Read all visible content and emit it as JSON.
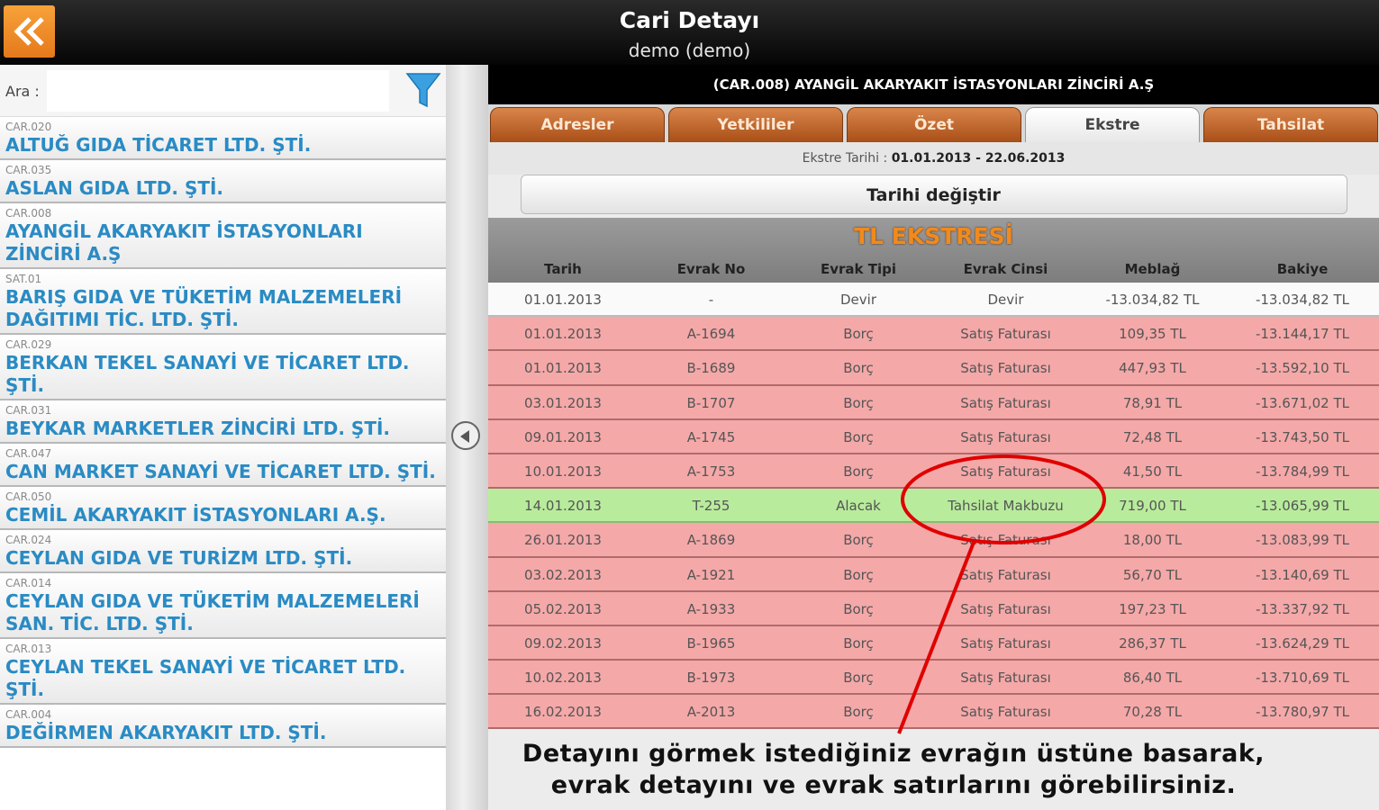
{
  "header": {
    "title": "Cari Detayı",
    "subtitle": "demo (demo)"
  },
  "search": {
    "label": "Ara :",
    "value": "",
    "placeholder": ""
  },
  "customers": [
    {
      "code": "CAR.020",
      "name": "ALTUĞ GIDA TİCARET LTD. ŞTİ."
    },
    {
      "code": "CAR.035",
      "name": "ASLAN GIDA LTD. ŞTİ."
    },
    {
      "code": "CAR.008",
      "name": "AYANGİL AKARYAKIT İSTASYONLARI ZİNCİRİ A.Ş"
    },
    {
      "code": "SAT.01",
      "name": "BARIŞ GIDA VE TÜKETİM MALZEMELERİ DAĞITIMI TİC. LTD. ŞTİ."
    },
    {
      "code": "CAR.029",
      "name": "BERKAN TEKEL SANAYİ VE TİCARET LTD. ŞTİ."
    },
    {
      "code": "CAR.031",
      "name": "BEYKAR MARKETLER ZİNCİRİ LTD. ŞTİ."
    },
    {
      "code": "CAR.047",
      "name": "CAN MARKET SANAYİ VE TİCARET LTD. ŞTİ."
    },
    {
      "code": "CAR.050",
      "name": "CEMİL AKARYAKIT İSTASYONLARI A.Ş."
    },
    {
      "code": "CAR.024",
      "name": "CEYLAN GIDA VE TURİZM LTD. ŞTİ."
    },
    {
      "code": "CAR.014",
      "name": "CEYLAN GIDA VE TÜKETİM MALZEMELERİ SAN. TİC. LTD. ŞTİ."
    },
    {
      "code": "CAR.013",
      "name": "CEYLAN TEKEL SANAYİ VE TİCARET LTD. ŞTİ."
    },
    {
      "code": "CAR.004",
      "name": "DEĞİRMEN AKARYAKIT LTD. ŞTİ."
    }
  ],
  "detail": {
    "customer_title": "(CAR.008) AYANGİL AKARYAKIT İSTASYONLARI ZİNCİRİ A.Ş",
    "tabs": [
      {
        "label": "Adresler",
        "active": false
      },
      {
        "label": "Yetkililer",
        "active": false
      },
      {
        "label": "Özet",
        "active": false
      },
      {
        "label": "Ekstre",
        "active": true
      },
      {
        "label": "Tahsilat",
        "active": false
      }
    ],
    "date_label": "Ekstre Tarihi :",
    "date_range": "01.01.2013 - 22.06.2013",
    "change_date_label": "Tarihi değiştir",
    "table_title": "TL EKSTRESİ",
    "columns": [
      "Tarih",
      "Evrak No",
      "Evrak Tipi",
      "Evrak Cinsi",
      "Meblağ",
      "Bakiye"
    ],
    "rows": [
      {
        "cells": [
          "01.01.2013",
          "-",
          "Devir",
          "Devir",
          "-13.034,82 TL",
          "-13.034,82 TL"
        ],
        "kind": "white"
      },
      {
        "cells": [
          "01.01.2013",
          "A-1694",
          "Borç",
          "Satış Faturası",
          "109,35 TL",
          "-13.144,17 TL"
        ],
        "kind": "red"
      },
      {
        "cells": [
          "01.01.2013",
          "B-1689",
          "Borç",
          "Satış Faturası",
          "447,93 TL",
          "-13.592,10 TL"
        ],
        "kind": "red"
      },
      {
        "cells": [
          "03.01.2013",
          "B-1707",
          "Borç",
          "Satış Faturası",
          "78,91 TL",
          "-13.671,02 TL"
        ],
        "kind": "red"
      },
      {
        "cells": [
          "09.01.2013",
          "A-1745",
          "Borç",
          "Satış Faturası",
          "72,48 TL",
          "-13.743,50 TL"
        ],
        "kind": "red"
      },
      {
        "cells": [
          "10.01.2013",
          "A-1753",
          "Borç",
          "Satış Faturası",
          "41,50 TL",
          "-13.784,99 TL"
        ],
        "kind": "red"
      },
      {
        "cells": [
          "14.01.2013",
          "T-255",
          "Alacak",
          "Tahsilat Makbuzu",
          "719,00 TL",
          "-13.065,99 TL"
        ],
        "kind": "green"
      },
      {
        "cells": [
          "26.01.2013",
          "A-1869",
          "Borç",
          "Satış Faturası",
          "18,00 TL",
          "-13.083,99 TL"
        ],
        "kind": "red"
      },
      {
        "cells": [
          "03.02.2013",
          "A-1921",
          "Borç",
          "Satış Faturası",
          "56,70 TL",
          "-13.140,69 TL"
        ],
        "kind": "red"
      },
      {
        "cells": [
          "05.02.2013",
          "A-1933",
          "Borç",
          "Satış Faturası",
          "197,23 TL",
          "-13.337,92 TL"
        ],
        "kind": "red"
      },
      {
        "cells": [
          "09.02.2013",
          "B-1965",
          "Borç",
          "Satış Faturası",
          "286,37 TL",
          "-13.624,29 TL"
        ],
        "kind": "red"
      },
      {
        "cells": [
          "10.02.2013",
          "B-1973",
          "Borç",
          "Satış Faturası",
          "86,40 TL",
          "-13.710,69 TL"
        ],
        "kind": "red"
      },
      {
        "cells": [
          "16.02.2013",
          "A-2013",
          "Borç",
          "Satış Faturası",
          "70,28 TL",
          "-13.780,97 TL"
        ],
        "kind": "red"
      }
    ]
  },
  "annotation": {
    "line1": "Detayını görmek istediğiniz evrağın üstüne basarak,",
    "line2": "evrak detayını ve evrak satırlarını görebilirsiniz.",
    "color": "#e00000"
  },
  "colors": {
    "accent": "#f08a1e",
    "link": "#2a8bc4",
    "debit_row": "#f5a8a8",
    "credit_row": "#b8ec9c"
  }
}
